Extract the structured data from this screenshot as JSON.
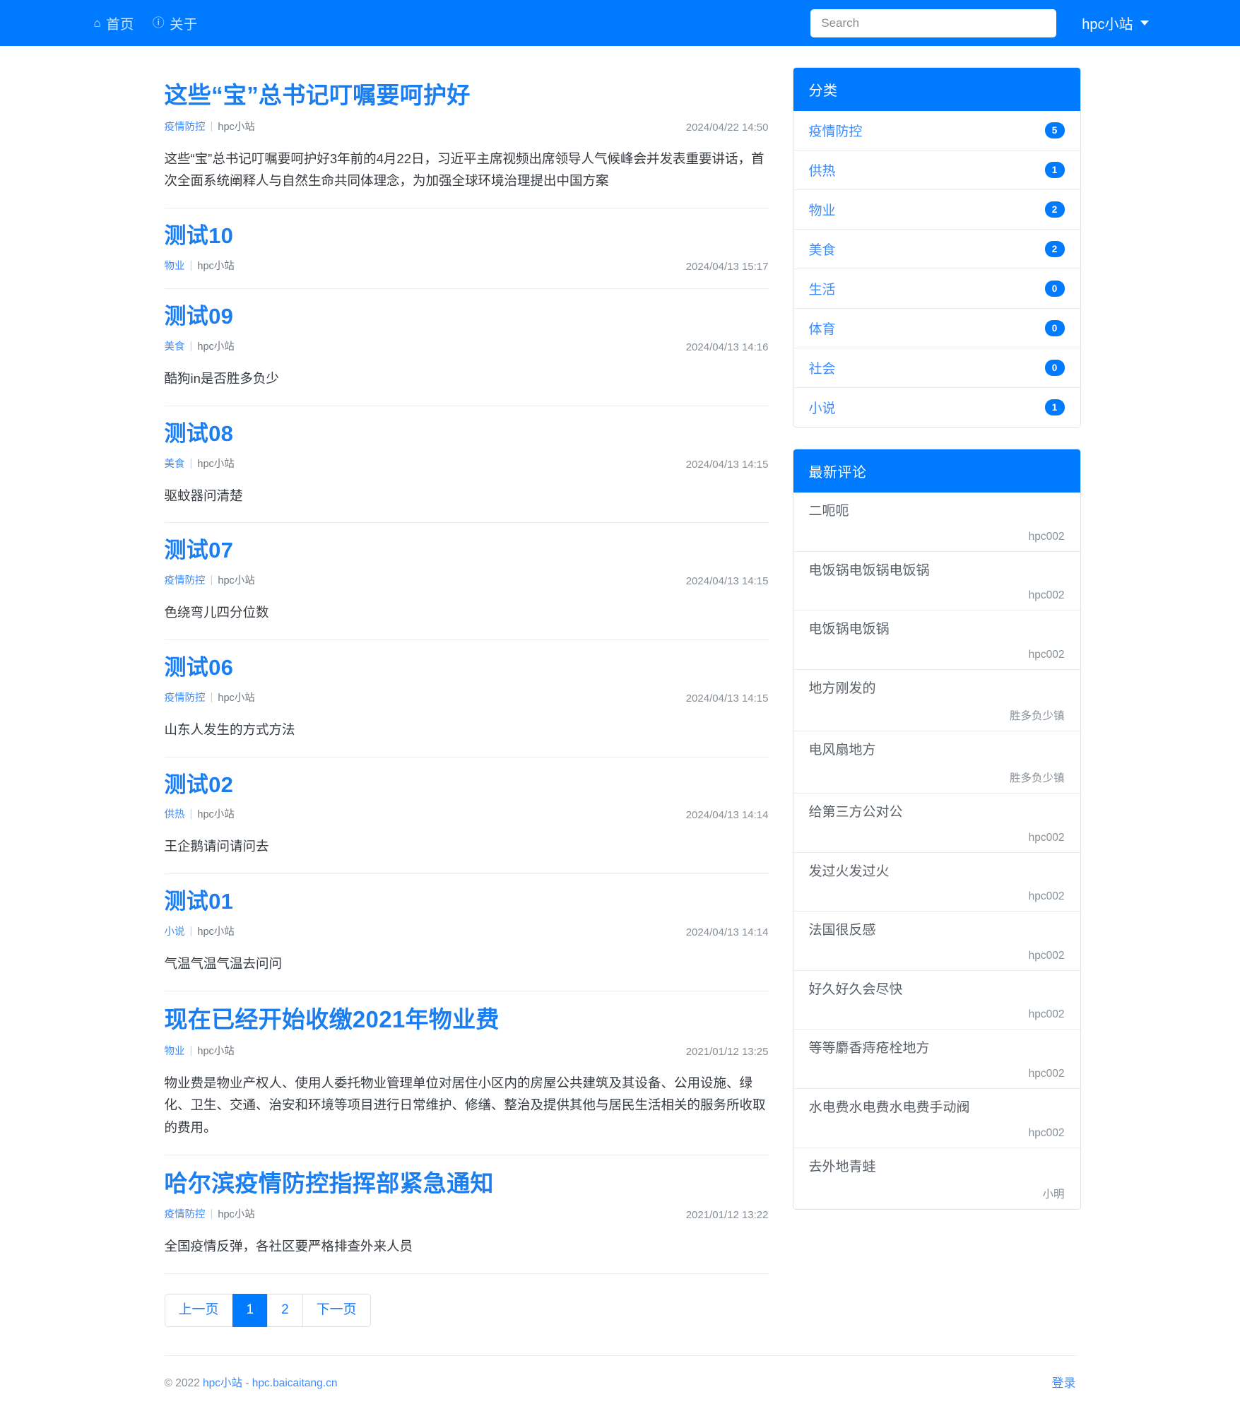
{
  "navbar": {
    "links": [
      {
        "icon": "home-icon",
        "glyph": "⌂",
        "label": "首页"
      },
      {
        "icon": "info-icon",
        "glyph": "ⓘ",
        "label": "关于"
      }
    ],
    "search": {
      "placeholder": "Search",
      "value": ""
    },
    "user": "hpc小站"
  },
  "articles": [
    {
      "title": "这些“宝”总书记叮嘱要呵护好",
      "category": "疫情防控",
      "author": "hpc小站",
      "date": "2024/04/22 14:50",
      "summary": "这些“宝”总书记叮嘱要呵护好3年前的4月22日，习近平主席视频出席领导人气候峰会并发表重要讲话，首次全面系统阐释人与自然生命共同体理念，为加强全球环境治理提出中国方案"
    },
    {
      "title": "测试10",
      "category": "物业",
      "author": "hpc小站",
      "date": "2024/04/13 15:17",
      "summary": ""
    },
    {
      "title": "测试09",
      "category": "美食",
      "author": "hpc小站",
      "date": "2024/04/13 14:16",
      "summary": "酷狗in是否胜多负少"
    },
    {
      "title": "测试08",
      "category": "美食",
      "author": "hpc小站",
      "date": "2024/04/13 14:15",
      "summary": "驱蚊器问清楚"
    },
    {
      "title": "测试07",
      "category": "疫情防控",
      "author": "hpc小站",
      "date": "2024/04/13 14:15",
      "summary": "色绕弯儿四分位数"
    },
    {
      "title": "测试06",
      "category": "疫情防控",
      "author": "hpc小站",
      "date": "2024/04/13 14:15",
      "summary": "山东人发生的方式方法"
    },
    {
      "title": "测试02",
      "category": "供热",
      "author": "hpc小站",
      "date": "2024/04/13 14:14",
      "summary": "王企鹅请问请问去"
    },
    {
      "title": "测试01",
      "category": "小说",
      "author": "hpc小站",
      "date": "2024/04/13 14:14",
      "summary": "气温气温气温去问问"
    },
    {
      "title": "现在已经开始收缴2021年物业费",
      "category": "物业",
      "author": "hpc小站",
      "date": "2021/01/12 13:25",
      "summary": "物业费是物业产权人、使用人委托物业管理单位对居住小区内的房屋公共建筑及其设备、公用设施、绿化、卫生、交通、治安和环境等项目进行日常维护、修缮、整治及提供其他与居民生活相关的服务所收取的费用。"
    },
    {
      "title": "哈尔滨疫情防控指挥部紧急通知",
      "category": "疫情防控",
      "author": "hpc小站",
      "date": "2021/01/12 13:22",
      "summary": "全国疫情反弹，各社区要严格排查外来人员"
    }
  ],
  "pagination": {
    "prev": "上一页",
    "pages": [
      "1",
      "2"
    ],
    "active": "1",
    "next": "下一页"
  },
  "sidebar": {
    "categories_title": "分类",
    "categories": [
      {
        "label": "疫情防控",
        "count": "5"
      },
      {
        "label": "供热",
        "count": "1"
      },
      {
        "label": "物业",
        "count": "2"
      },
      {
        "label": "美食",
        "count": "2"
      },
      {
        "label": "生活",
        "count": "0"
      },
      {
        "label": "体育",
        "count": "0"
      },
      {
        "label": "社会",
        "count": "0"
      },
      {
        "label": "小说",
        "count": "1"
      }
    ],
    "comments_title": "最新评论",
    "comments": [
      {
        "text": "二呃呃",
        "author": "hpc002"
      },
      {
        "text": "电饭锅电饭锅电饭锅",
        "author": "hpc002"
      },
      {
        "text": "电饭锅电饭锅",
        "author": "hpc002"
      },
      {
        "text": "地方刚发的",
        "author": "胜多负少镇"
      },
      {
        "text": "电风扇地方",
        "author": "胜多负少镇"
      },
      {
        "text": "给第三方公对公",
        "author": "hpc002"
      },
      {
        "text": "发过火发过火",
        "author": "hpc002"
      },
      {
        "text": "法国很反感",
        "author": "hpc002"
      },
      {
        "text": "好久好久会尽快",
        "author": "hpc002"
      },
      {
        "text": "等等麝香痔疮栓地方",
        "author": "hpc002"
      },
      {
        "text": "水电费水电费水电费手动阀",
        "author": "hpc002"
      },
      {
        "text": "去外地青蛙",
        "author": "小明"
      }
    ]
  },
  "footer": {
    "copyright_prefix": "© 2022 ",
    "site_name": "hpc小站",
    "separator": " - ",
    "domain": "hpc.baicaitang.cn",
    "login": "登录"
  },
  "colors": {
    "brand": "#007bff",
    "link": "#1a7ef0",
    "muted": "#868e96"
  }
}
